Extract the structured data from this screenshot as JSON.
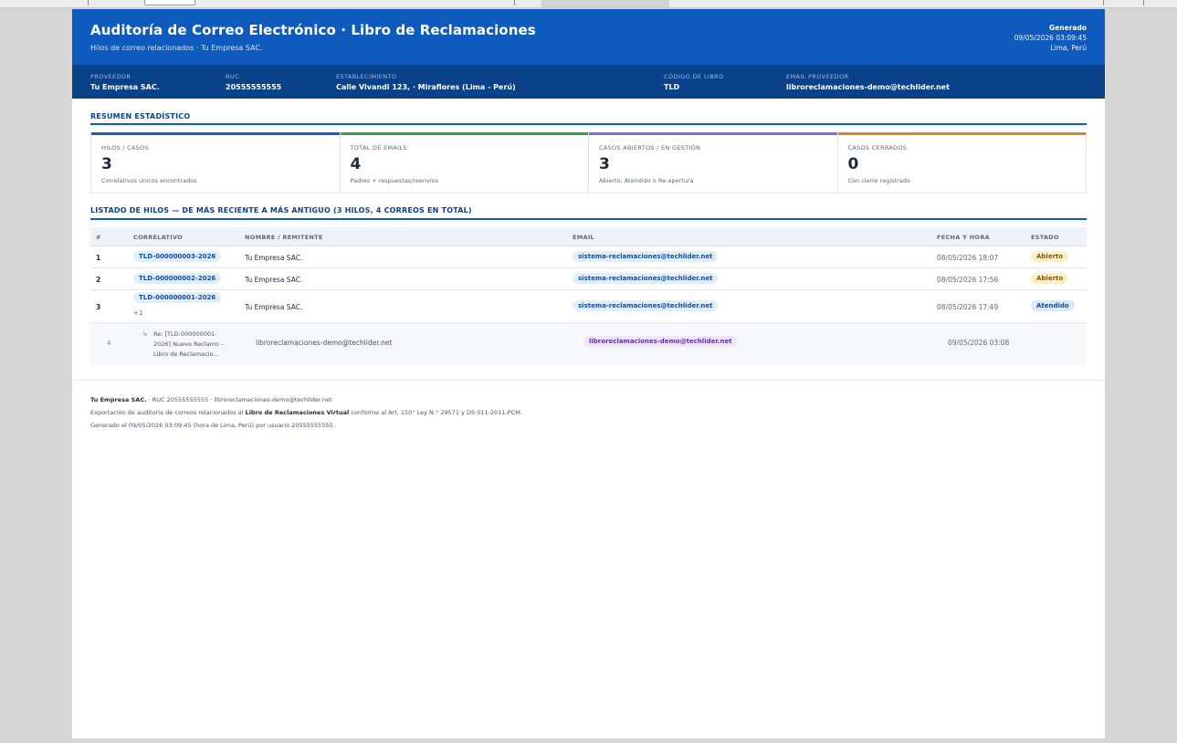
{
  "header": {
    "title": "Auditoría de Correo Electrónico · Libro de Reclamaciones",
    "subtitle": "Hilos de correo relacionados · Tu Empresa SAC.",
    "generated_label": "Generado",
    "generated_datetime": "09/05/2026 03:09:45",
    "location": "Lima, Perú"
  },
  "meta": {
    "provider_label": "PROVEEDOR",
    "provider": "Tu Empresa SAC.",
    "ruc_label": "RUC",
    "ruc": "20555555555",
    "establishment_label": "ESTABLECIMIENTO",
    "establishment": "Calle Vivandi 123, · Miraflores (Lima - Perú)",
    "book_code_label": "CÓDIGO DE LIBRO",
    "book_code": "TLD",
    "email_label": "EMAIL PROVEEDOR",
    "email": "libroreclamaciones-demo@techlider.net"
  },
  "summary": {
    "title": "RESUMEN ESTADÍSTICO",
    "cards": [
      {
        "label": "HILOS / CASOS",
        "value": "3",
        "desc": "Correlativos únicos encontrados",
        "color": "#1a5fb4"
      },
      {
        "label": "TOTAL DE EMAILS",
        "value": "4",
        "desc": "Padres + respuestas/reenvíos",
        "color": "#2fa24a"
      },
      {
        "label": "CASOS ABIERTOS / EN GESTIÓN",
        "value": "3",
        "desc": "Abierto, Atendido o Re-apertura",
        "color": "#7b6fd8"
      },
      {
        "label": "CASOS CERRADOS",
        "value": "0",
        "desc": "Con cierre registrado",
        "color": "#d6842a"
      }
    ]
  },
  "listing": {
    "title": "LISTADO DE HILOS — DE MÁS RECIENTE A MÁS ANTIGUO (3 HILOS, 4 CORREOS EN TOTAL)",
    "headers": {
      "num": "#",
      "correlativo": "CORRELATIVO",
      "nombre": "NOMBRE / REMITENTE",
      "email": "EMAIL",
      "fecha": "FECHA Y HORA",
      "estado": "ESTADO"
    },
    "rows": [
      {
        "num": "1",
        "correlativo": "TLD-000000003-2026",
        "nombre": "Tu Empresa SAC.",
        "email": "sistema-reclamaciones@techlider.net",
        "fecha": "08/05/2026 18:07",
        "estado": "Abierto"
      },
      {
        "num": "2",
        "correlativo": "TLD-000000002-2026",
        "nombre": "Tu Empresa SAC.",
        "email": "sistema-reclamaciones@techlider.net",
        "fecha": "08/05/2026 17:56",
        "estado": "Abierto"
      },
      {
        "num": "3",
        "correlativo": "TLD-000000001-2026",
        "extra": "+1",
        "nombre": "Tu Empresa SAC.",
        "email": "sistema-reclamaciones@techlider.net",
        "fecha": "08/05/2026 17:49",
        "estado": "Atendido"
      }
    ],
    "child": {
      "num": "4",
      "arrow": "↳",
      "subject_l1": "Re: [TLD-000000001-",
      "subject_l2": "2026] Nuevo Reclamo –",
      "subject_l3": "Libro de Reclamacio...",
      "nombre": "libroreclamaciones-demo@techlider.net",
      "email": "libroreclamaciones-demo@techlider.net",
      "fecha": "09/05/2026 03:08"
    }
  },
  "footer": {
    "company": "Tu Empresa SAC.",
    "line1_rest": "· RUC 20555555555 · libroreclamaciones-demo@techlider.net",
    "line2_pre": "Exportación de auditoría de correos relacionados al",
    "line2_bold": "Libro de Reclamaciones Virtual",
    "line2_post": "conforme al Art. 150° Ley N.° 29571 y DS 011-2011-PCM.",
    "line3": "Generado el 09/05/2026 03:09:45 (hora de Lima, Perú) por usuario 20555555555."
  }
}
